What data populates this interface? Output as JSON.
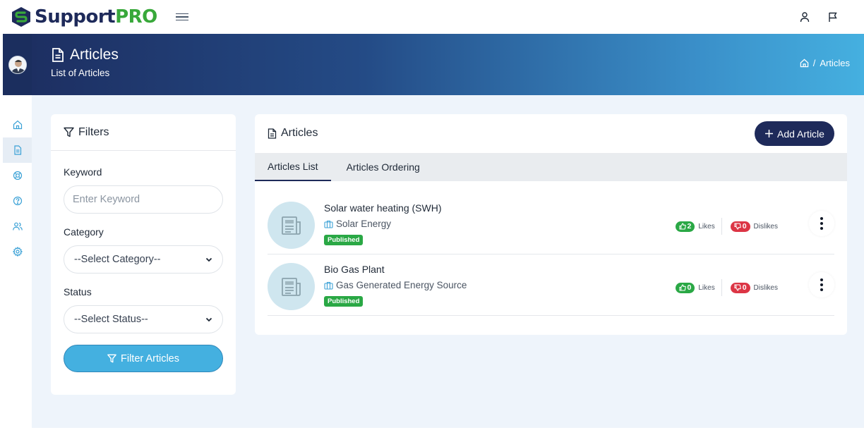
{
  "app": {
    "logo_part1": "Support",
    "logo_part2": "PRO"
  },
  "page": {
    "title": "Articles",
    "subtitle": "List of Articles",
    "breadcrumb": [
      "Articles"
    ]
  },
  "filters": {
    "heading": "Filters",
    "keyword_label": "Keyword",
    "keyword_placeholder": "Enter Keyword",
    "keyword_value": "",
    "category_label": "Category",
    "category_selected": "--Select Category--",
    "status_label": "Status",
    "status_selected": "--Select Status--",
    "submit_label": "Filter Articles"
  },
  "articles": {
    "heading": "Articles",
    "add_label": "Add Article",
    "tabs": [
      {
        "label": "Articles List",
        "active": true
      },
      {
        "label": "Articles Ordering",
        "active": false
      }
    ],
    "items": [
      {
        "title": "Solar water heating (SWH)",
        "category": "Solar Energy",
        "status": "Published",
        "likes": "2",
        "likes_label": "Likes",
        "dislikes": "0",
        "dislikes_label": "Dislikes"
      },
      {
        "title": "Bio Gas Plant",
        "category": "Gas Generated Energy Source",
        "status": "Published",
        "likes": "0",
        "likes_label": "Likes",
        "dislikes": "0",
        "dislikes_label": "Dislikes"
      }
    ]
  },
  "sidebar": {
    "icons": [
      "home-icon",
      "document-icon",
      "support-icon",
      "help-icon",
      "users-icon",
      "settings-icon"
    ]
  },
  "colors": {
    "brand_navy": "#1e2a5a",
    "brand_green": "#38a83a",
    "accent_blue": "#44b0e0",
    "like_green": "#2aa845",
    "dislike_red": "#dc3545"
  }
}
